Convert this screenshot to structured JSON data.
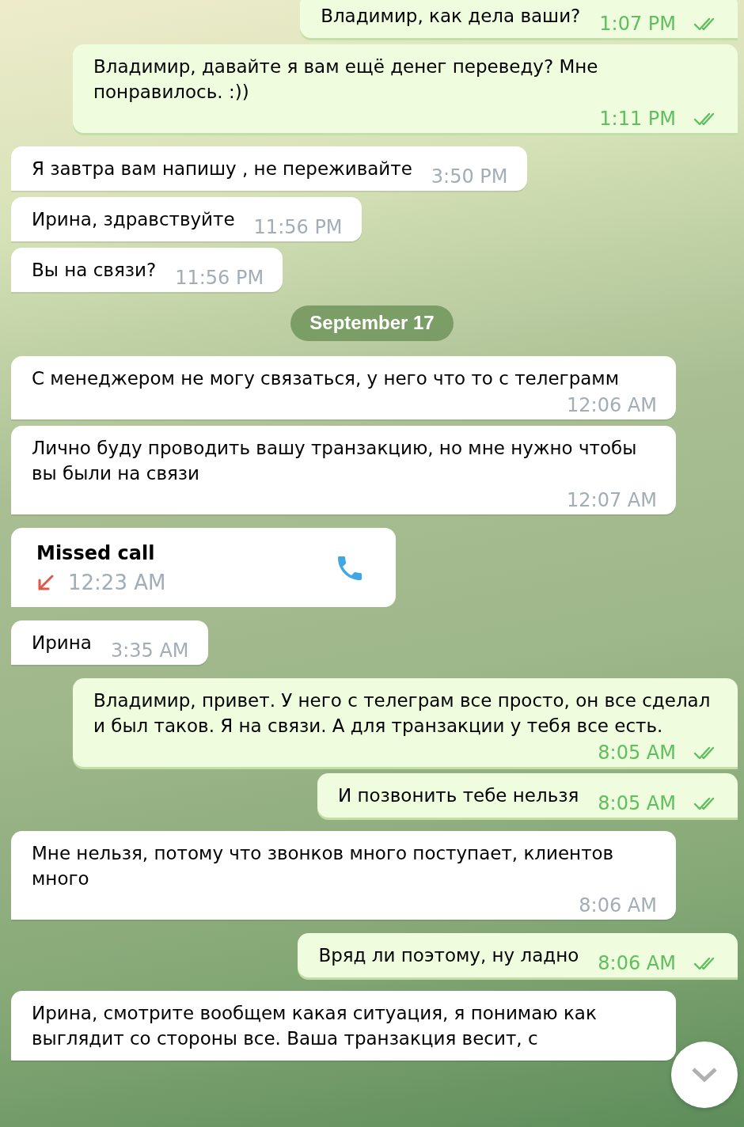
{
  "messages": [
    {
      "kind": "message",
      "outgoing": true,
      "text": "Владимир, как дела ваши?",
      "time": "1:07 PM",
      "read": true
    },
    {
      "kind": "message",
      "outgoing": true,
      "text": "Владимир, давайте я вам ещё денег переведу? Мне понравилось. :))",
      "time": "1:11 PM",
      "read": true
    },
    {
      "kind": "message",
      "outgoing": false,
      "text": "Я завтра вам напишу , не переживайте",
      "time": "3:50 PM"
    },
    {
      "kind": "message",
      "outgoing": false,
      "text": "Ирина, здравствуйте",
      "time": "11:56 PM"
    },
    {
      "kind": "message",
      "outgoing": false,
      "text": "Вы на связи?",
      "time": "11:56 PM"
    },
    {
      "kind": "date",
      "text": "September 17"
    },
    {
      "kind": "message",
      "outgoing": false,
      "text": "С менеджером не могу связаться, у него что то с телеграмм",
      "time": "12:06 AM"
    },
    {
      "kind": "message",
      "outgoing": false,
      "text": "Лично буду проводить вашу транзакцию, но мне нужно чтобы вы были на связи",
      "time": "12:07 AM"
    },
    {
      "kind": "call",
      "outgoing": false,
      "title": "Missed call",
      "missed": true,
      "time": "12:23 AM"
    },
    {
      "kind": "message",
      "outgoing": false,
      "text": "Ирина",
      "time": "3:35 AM"
    },
    {
      "kind": "message",
      "outgoing": true,
      "text": "Владимир, привет. У него с телеграм все просто, он все сделал и был таков. Я на связи. А для транзакции у тебя все есть.",
      "time": "8:05 AM",
      "read": true
    },
    {
      "kind": "message",
      "outgoing": true,
      "text": "И позвонить тебе нельзя",
      "time": "8:05 AM",
      "read": true
    },
    {
      "kind": "message",
      "outgoing": false,
      "text": "Мне нельзя, потому что звонков много поступает, клиентов много",
      "time": "8:06 AM"
    },
    {
      "kind": "message",
      "outgoing": true,
      "text": "Вряд ли поэтому, ну ладно",
      "time": "8:06 AM",
      "read": true
    },
    {
      "kind": "message",
      "outgoing": false,
      "text": "Ирина, смотрите вообщем какая ситуация, я понимаю как выглядит со стороны все. Ваша транзакция весит, с"
    }
  ]
}
